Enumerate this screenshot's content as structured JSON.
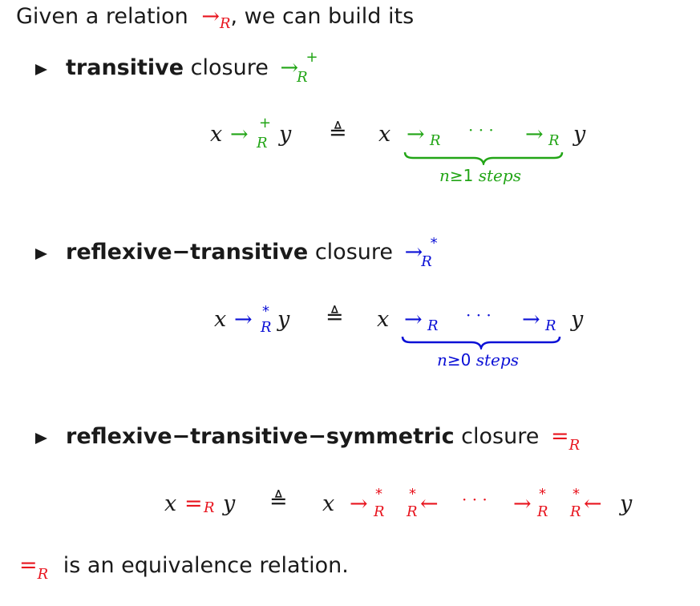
{
  "intro": {
    "text_before": "Given a relation",
    "arrow": "→",
    "sub": "R",
    "text_after": ", we can build its"
  },
  "items": [
    {
      "bold": "transitive",
      "rest": "closure",
      "symbol": "→",
      "sup": "+",
      "sub": "R",
      "formula": {
        "lhs_x": "x",
        "lhs_arrow": "→",
        "lhs_sup": "+",
        "lhs_sub": "R",
        "lhs_y": "y",
        "defeq": "≜",
        "rhs_x": "x",
        "rhs_arrow1": "→",
        "rhs_sub1": "R",
        "dots": "· · ·",
        "rhs_arrow2": "→",
        "rhs_sub2": "R",
        "rhs_y": "y",
        "brace_n": "n",
        "brace_ge": "≥",
        "brace_num": "1",
        "brace_steps": "steps"
      },
      "color": "#22a516"
    },
    {
      "bold": "reflexive−transitive",
      "rest": "closure",
      "symbol": "→",
      "sup": "*",
      "sub": "R",
      "formula": {
        "lhs_x": "x",
        "lhs_arrow": "→",
        "lhs_sup": "*",
        "lhs_sub": "R",
        "lhs_y": "y",
        "defeq": "≜",
        "rhs_x": "x",
        "rhs_arrow1": "→",
        "rhs_sub1": "R",
        "dots": "· · ·",
        "rhs_arrow2": "→",
        "rhs_sub2": "R",
        "rhs_y": "y",
        "brace_n": "n",
        "brace_ge": "≥",
        "brace_num": "0",
        "brace_steps": "steps"
      },
      "color": "#0b10d6"
    },
    {
      "bold": "reflexive−transitive−symmetric",
      "rest": "closure",
      "symbol": "=",
      "sub": "R",
      "formula": {
        "lhs_x": "x",
        "lhs_eq": "=",
        "lhs_sub": "R",
        "lhs_y": "y",
        "defeq": "≜",
        "rhs_x": "x",
        "r1_arrow": "→",
        "r1_sup": "*",
        "r1_sub": "R",
        "l1_arrow": "←",
        "l1_sup": "*",
        "l1_sub": "R",
        "dots": "· · ·",
        "r2_arrow": "→",
        "r2_sup": "*",
        "r2_sub": "R",
        "l2_arrow": "←",
        "l2_sup": "*",
        "l2_sub": "R",
        "rhs_y": "y"
      },
      "color": "#e8141e"
    }
  ],
  "conclusion": {
    "symbol": "=",
    "sub": "R",
    "text": "is an equivalence relation."
  },
  "colors": {
    "relation": "#e8141e",
    "plus_closure": "#22a516",
    "star_closure": "#0b10d6",
    "text": "#1a1a1a"
  }
}
